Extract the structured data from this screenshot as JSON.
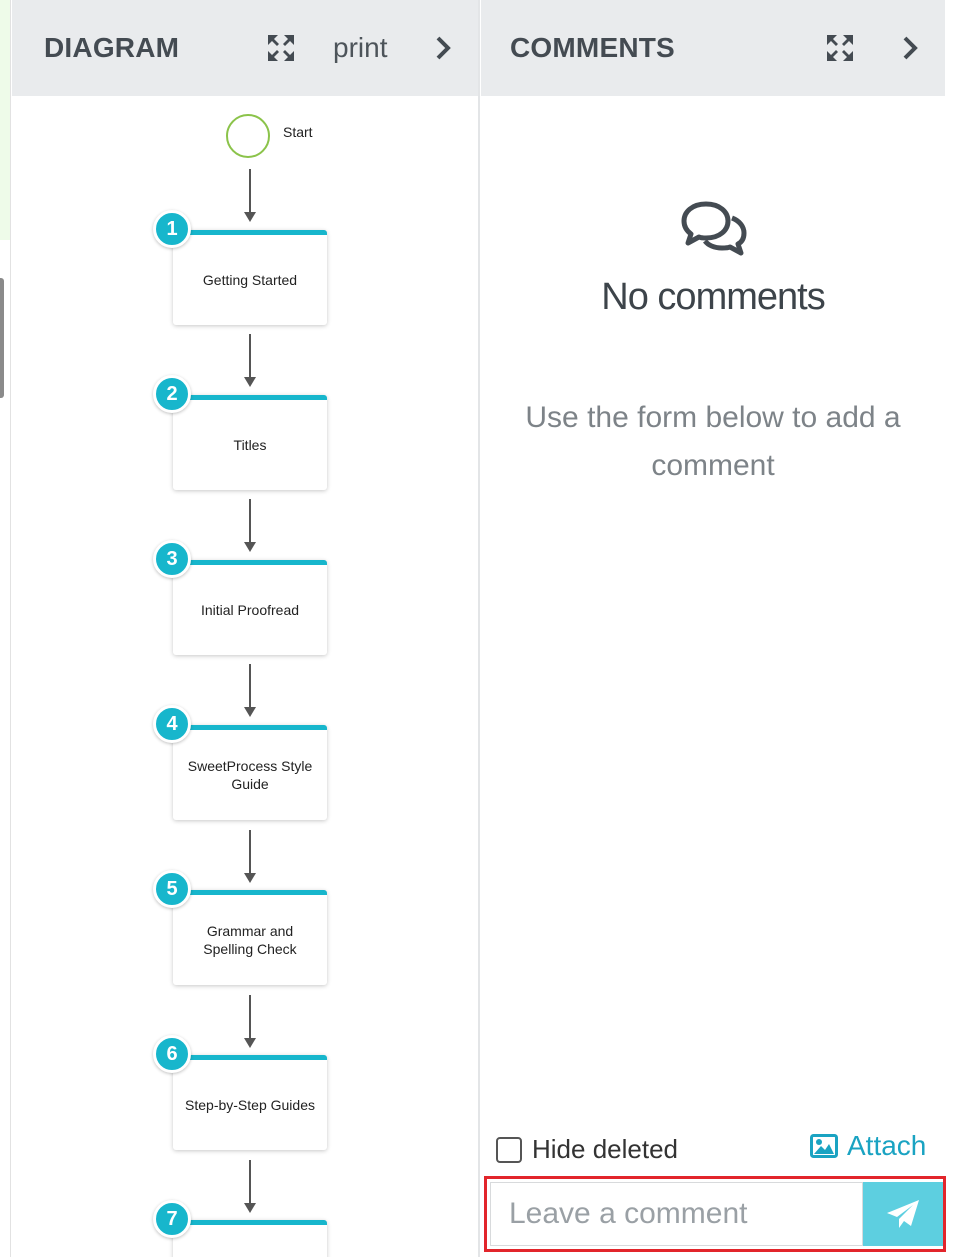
{
  "diagram_panel": {
    "title": "DIAGRAM",
    "print_label": "print",
    "start_label": "Start",
    "steps": [
      {
        "number": "1",
        "label": "Getting Started"
      },
      {
        "number": "2",
        "label": "Titles"
      },
      {
        "number": "3",
        "label": "Initial Proofread"
      },
      {
        "number": "4",
        "label": "SweetProcess Style Guide"
      },
      {
        "number": "5",
        "label": "Grammar and Spelling Check"
      },
      {
        "number": "6",
        "label": "Step-by-Step Guides"
      },
      {
        "number": "7",
        "label": ""
      }
    ]
  },
  "comments_panel": {
    "title": "COMMENTS",
    "empty_title": "No comments",
    "empty_subtitle": "Use the form below to add a comment",
    "hide_deleted_label": "Hide deleted",
    "attach_label": "Attach",
    "comment_placeholder": "Leave a comment"
  },
  "colors": {
    "accent": "#17b6cc",
    "start_circle": "#8bc34a",
    "highlight_border": "#e2252b",
    "send_button": "#5dcfe0",
    "attach_link": "#1aa3c2"
  },
  "icons": {
    "expand": "expand-arrows-icon",
    "chevron": "chevron-right-icon",
    "comments": "speech-bubbles-icon",
    "image": "image-icon",
    "send": "paper-plane-icon"
  }
}
